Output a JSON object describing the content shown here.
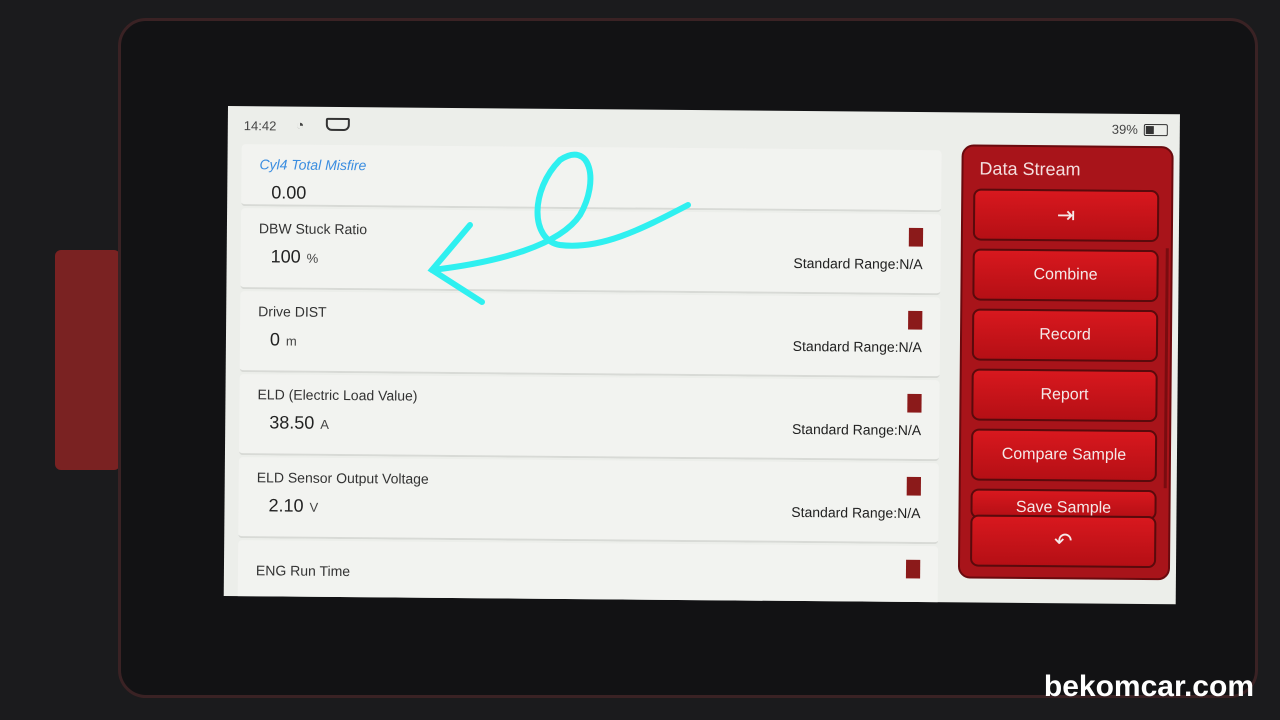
{
  "status": {
    "time": "14:42",
    "battery": "39%",
    "icons": [
      "wifi-icon",
      "obd-connector-icon",
      "battery-icon"
    ]
  },
  "rows": [
    {
      "name": "Cyl4 Total Misfire",
      "value": "0.00",
      "unit": "",
      "range": "",
      "highlight": true
    },
    {
      "name": "DBW Stuck Ratio",
      "value": "100",
      "unit": "%",
      "range": "Standard Range:N/A"
    },
    {
      "name": "Drive DIST",
      "value": "0",
      "unit": "m",
      "range": "Standard Range:N/A"
    },
    {
      "name": "ELD (Electric Load Value)",
      "value": "38.50",
      "unit": "A",
      "range": "Standard Range:N/A"
    },
    {
      "name": "ELD Sensor Output Voltage",
      "value": "2.10",
      "unit": "V",
      "range": "Standard Range:N/A"
    },
    {
      "name": "ENG Run Time",
      "value": "",
      "unit": "",
      "range": ""
    }
  ],
  "panel": {
    "title": "Data Stream",
    "buttons": {
      "exit": "",
      "combine": "Combine",
      "record": "Record",
      "report": "Report",
      "compare": "Compare Sample",
      "save": "Save Sample",
      "back": ""
    }
  },
  "watermark": "bekomcar.com",
  "colors": {
    "panel": "#a8141a",
    "annotation": "#2ff0f0",
    "highlight": "#3a8de0"
  }
}
